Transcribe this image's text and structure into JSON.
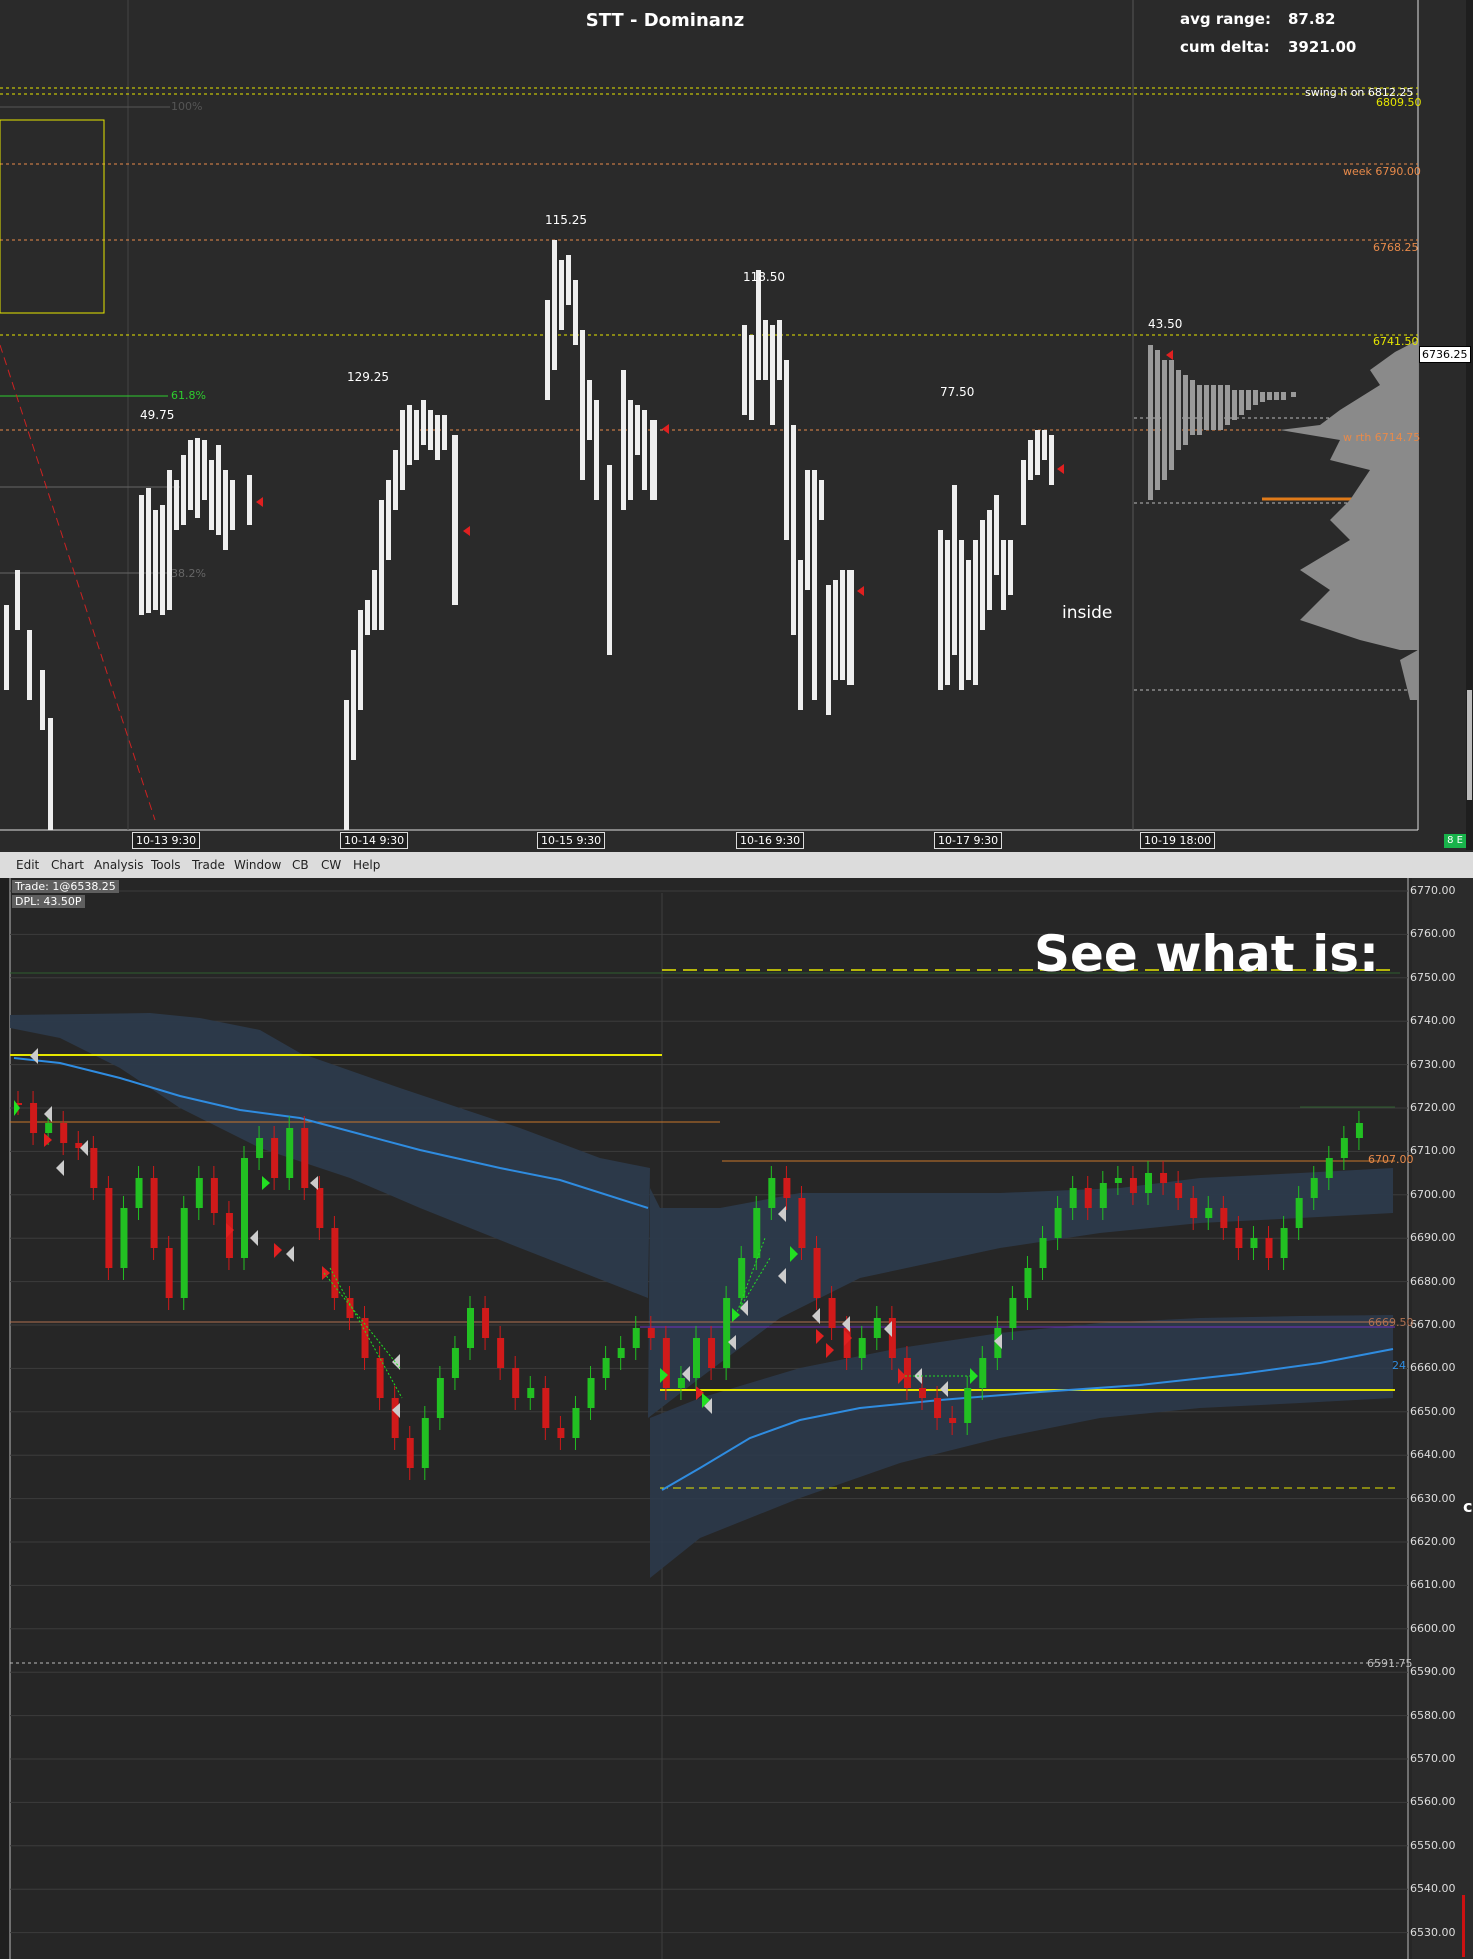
{
  "top_chart": {
    "title": "STT - Dominanz",
    "stats": [
      {
        "label": "avg range:",
        "value": "87.82"
      },
      {
        "label": "cum delta:",
        "value": "3921.00"
      }
    ],
    "levels": [
      {
        "label": "swing h on  6812.25",
        "color": "#ffffff"
      },
      {
        "label": "6809.50",
        "color": "#e6e600"
      },
      {
        "label": "week  6790.00",
        "color": "#e88a4a"
      },
      {
        "label": "6768.25",
        "color": "#e88a4a"
      },
      {
        "label": "6741.50",
        "color": "#e6e600"
      },
      {
        "label": "w rth  6714.75",
        "color": "#e88a4a"
      }
    ],
    "fib_labels": [
      "100%",
      "61.8%",
      "38.2%"
    ],
    "range_annotations": [
      "49.75",
      "129.25",
      "115.25",
      "118.50",
      "77.50",
      "43.50"
    ],
    "inside_label": "inside",
    "current_price": "6736.25",
    "x_ticks": [
      "10-13  9:30",
      "10-14  9:30",
      "10-15  9:30",
      "10-16  9:30",
      "10-17  9:30",
      "10-19  18:00"
    ],
    "badge": "8 E"
  },
  "menu": [
    "Edit",
    "Chart",
    "Analysis",
    "Tools",
    "Trade",
    "Window",
    "CB",
    "CW",
    "Help"
  ],
  "bottom_chart": {
    "trade_info": "Trade: 1@6538.25",
    "dpl_info": "DPL: 43.50P",
    "caption": "See what is:",
    "y_labels": [
      "6770.00",
      "6760.00",
      "6750.00",
      "6740.00",
      "6730.00",
      "6720.00",
      "6710.00",
      "6700.00",
      "6690.00",
      "6680.00",
      "6670.00",
      "6660.00",
      "6650.00",
      "6640.00",
      "6630.00",
      "6620.00",
      "6610.00",
      "6600.00",
      "6590.00",
      "6580.00",
      "6570.00",
      "6560.00",
      "6550.00",
      "6540.00",
      "6530.00"
    ],
    "inline_labels": [
      {
        "text": "6707.00",
        "color": "#e88a4a"
      },
      {
        "text": "6669.50",
        "color": "#b07050"
      },
      {
        "text": "24",
        "color": "#2f8ce0"
      },
      {
        "text": "6591.75",
        "color": "#bbbbbb"
      }
    ],
    "right_edge_text": "ch"
  }
}
